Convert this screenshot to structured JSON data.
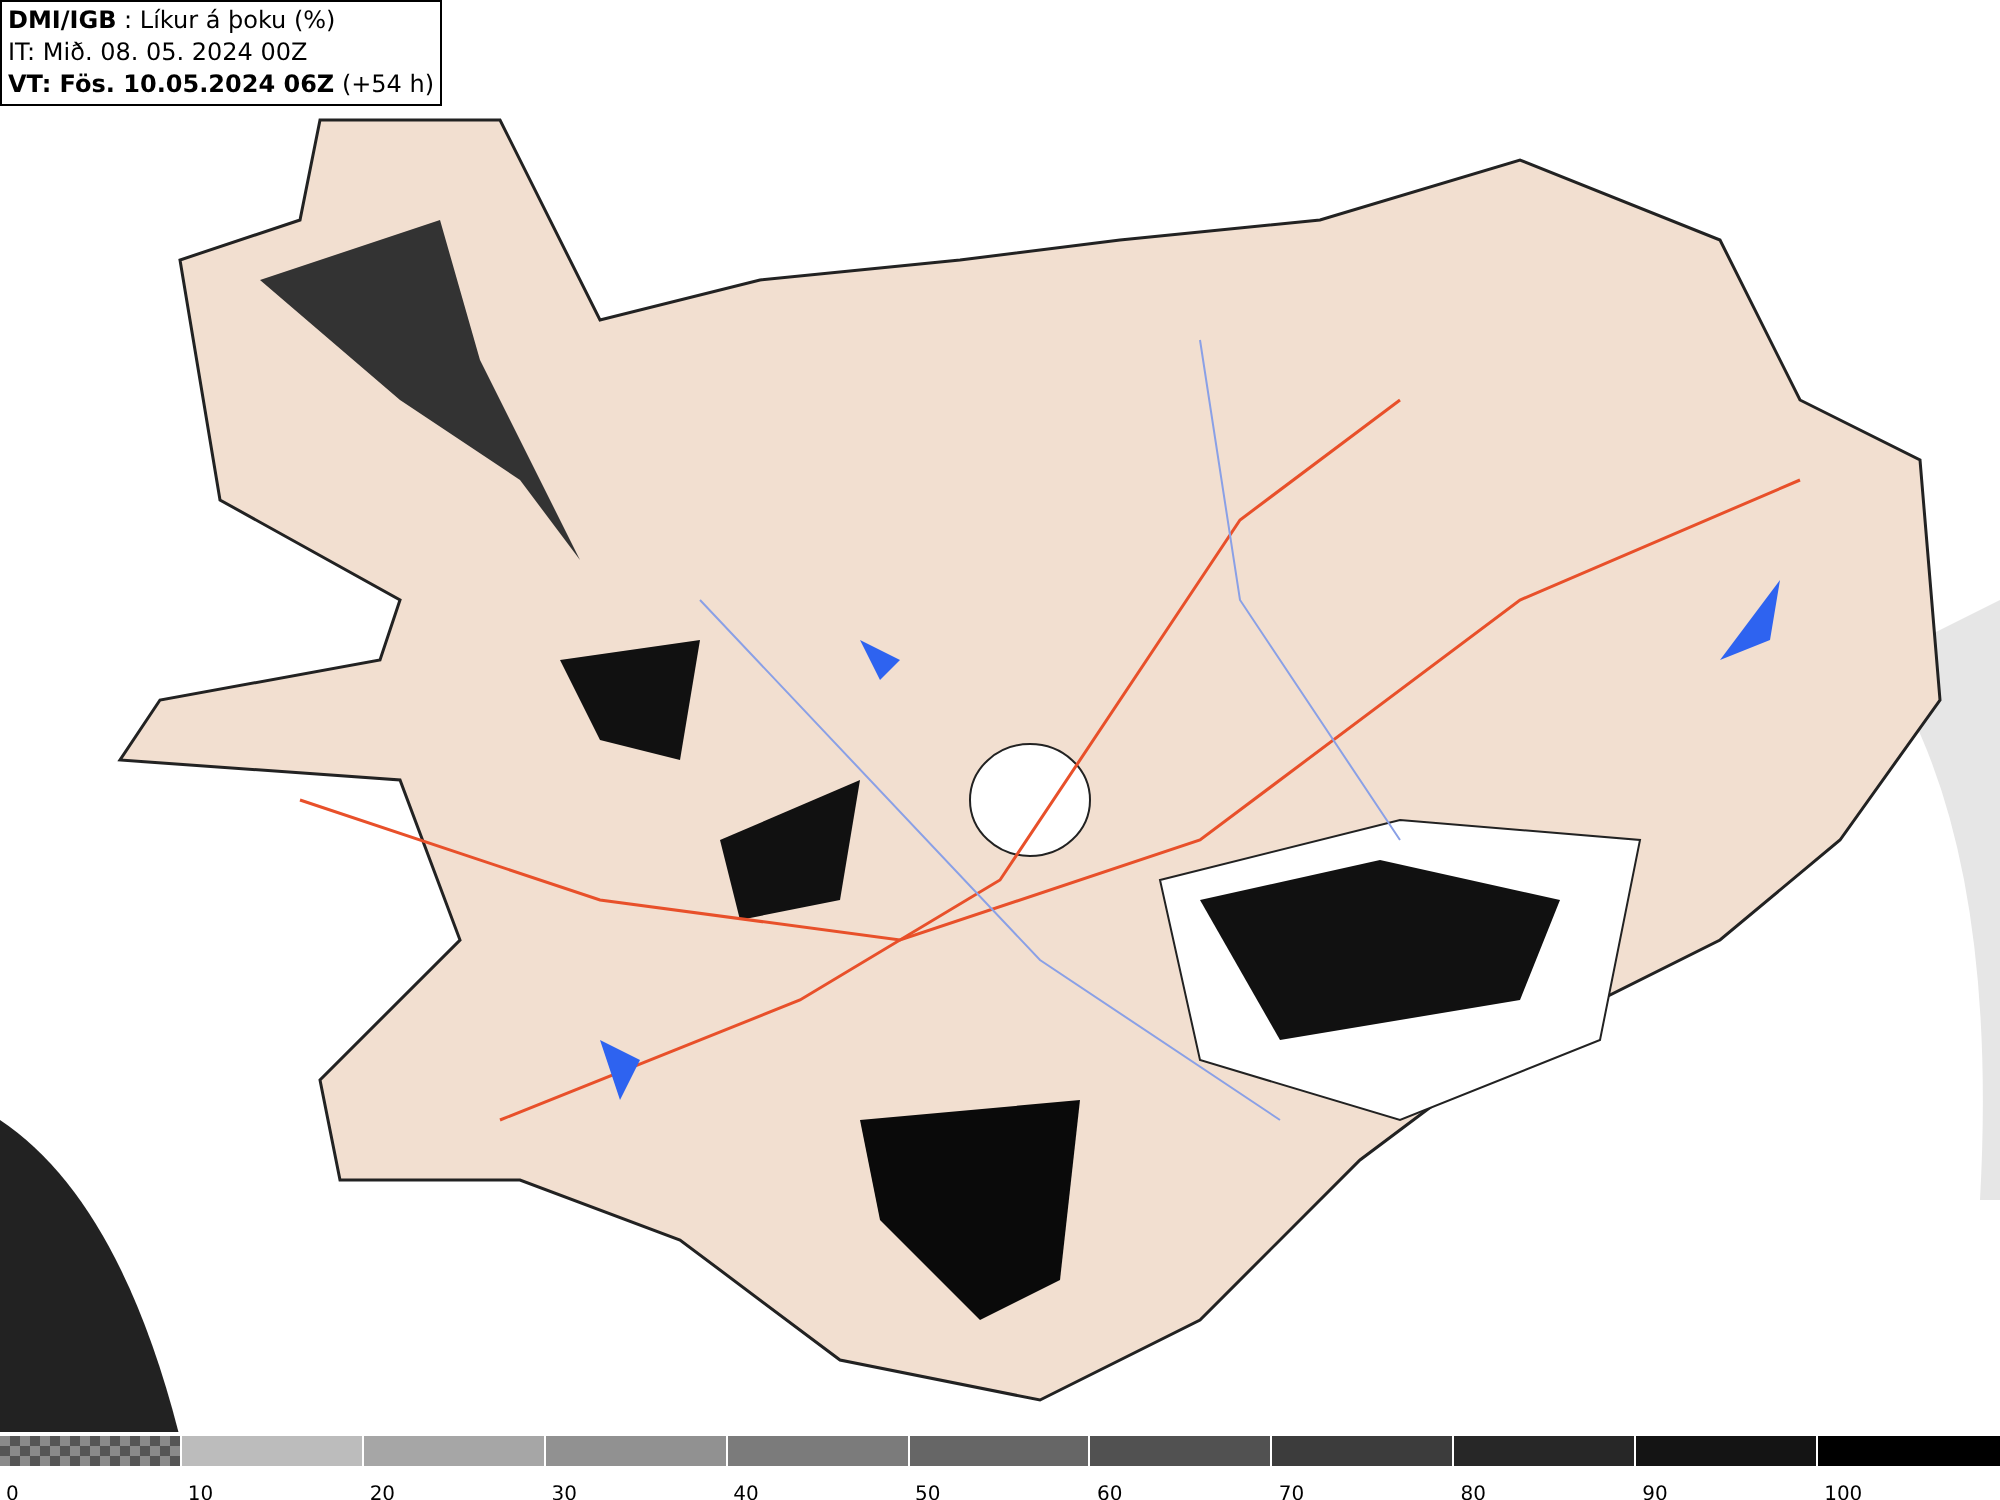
{
  "title_box": {
    "lines": [
      "**DMI/IGB** : Líkur á þoku (%)",
      "IT: Mið. 08. 05. 2024 00Z",
      "**VT: Fös. 10.05.2024 06Z** (+54 h)"
    ]
  },
  "legend": {
    "segments": [
      {
        "kind": "checker",
        "color": "#8a8a8a"
      },
      {
        "kind": "solid",
        "color": "#bcbcbc"
      },
      {
        "kind": "solid",
        "color": "#a6a6a6"
      },
      {
        "kind": "solid",
        "color": "#919191"
      },
      {
        "kind": "solid",
        "color": "#7b7b7b"
      },
      {
        "kind": "solid",
        "color": "#666666"
      },
      {
        "kind": "solid",
        "color": "#515151"
      },
      {
        "kind": "solid",
        "color": "#3c3c3c"
      },
      {
        "kind": "solid",
        "color": "#272727"
      },
      {
        "kind": "solid",
        "color": "#141414"
      },
      {
        "kind": "solid",
        "color": "#000000"
      }
    ],
    "labels": [
      "0",
      "10",
      "20",
      "30",
      "40",
      "50",
      "60",
      "70",
      "80",
      "90",
      "100"
    ]
  }
}
